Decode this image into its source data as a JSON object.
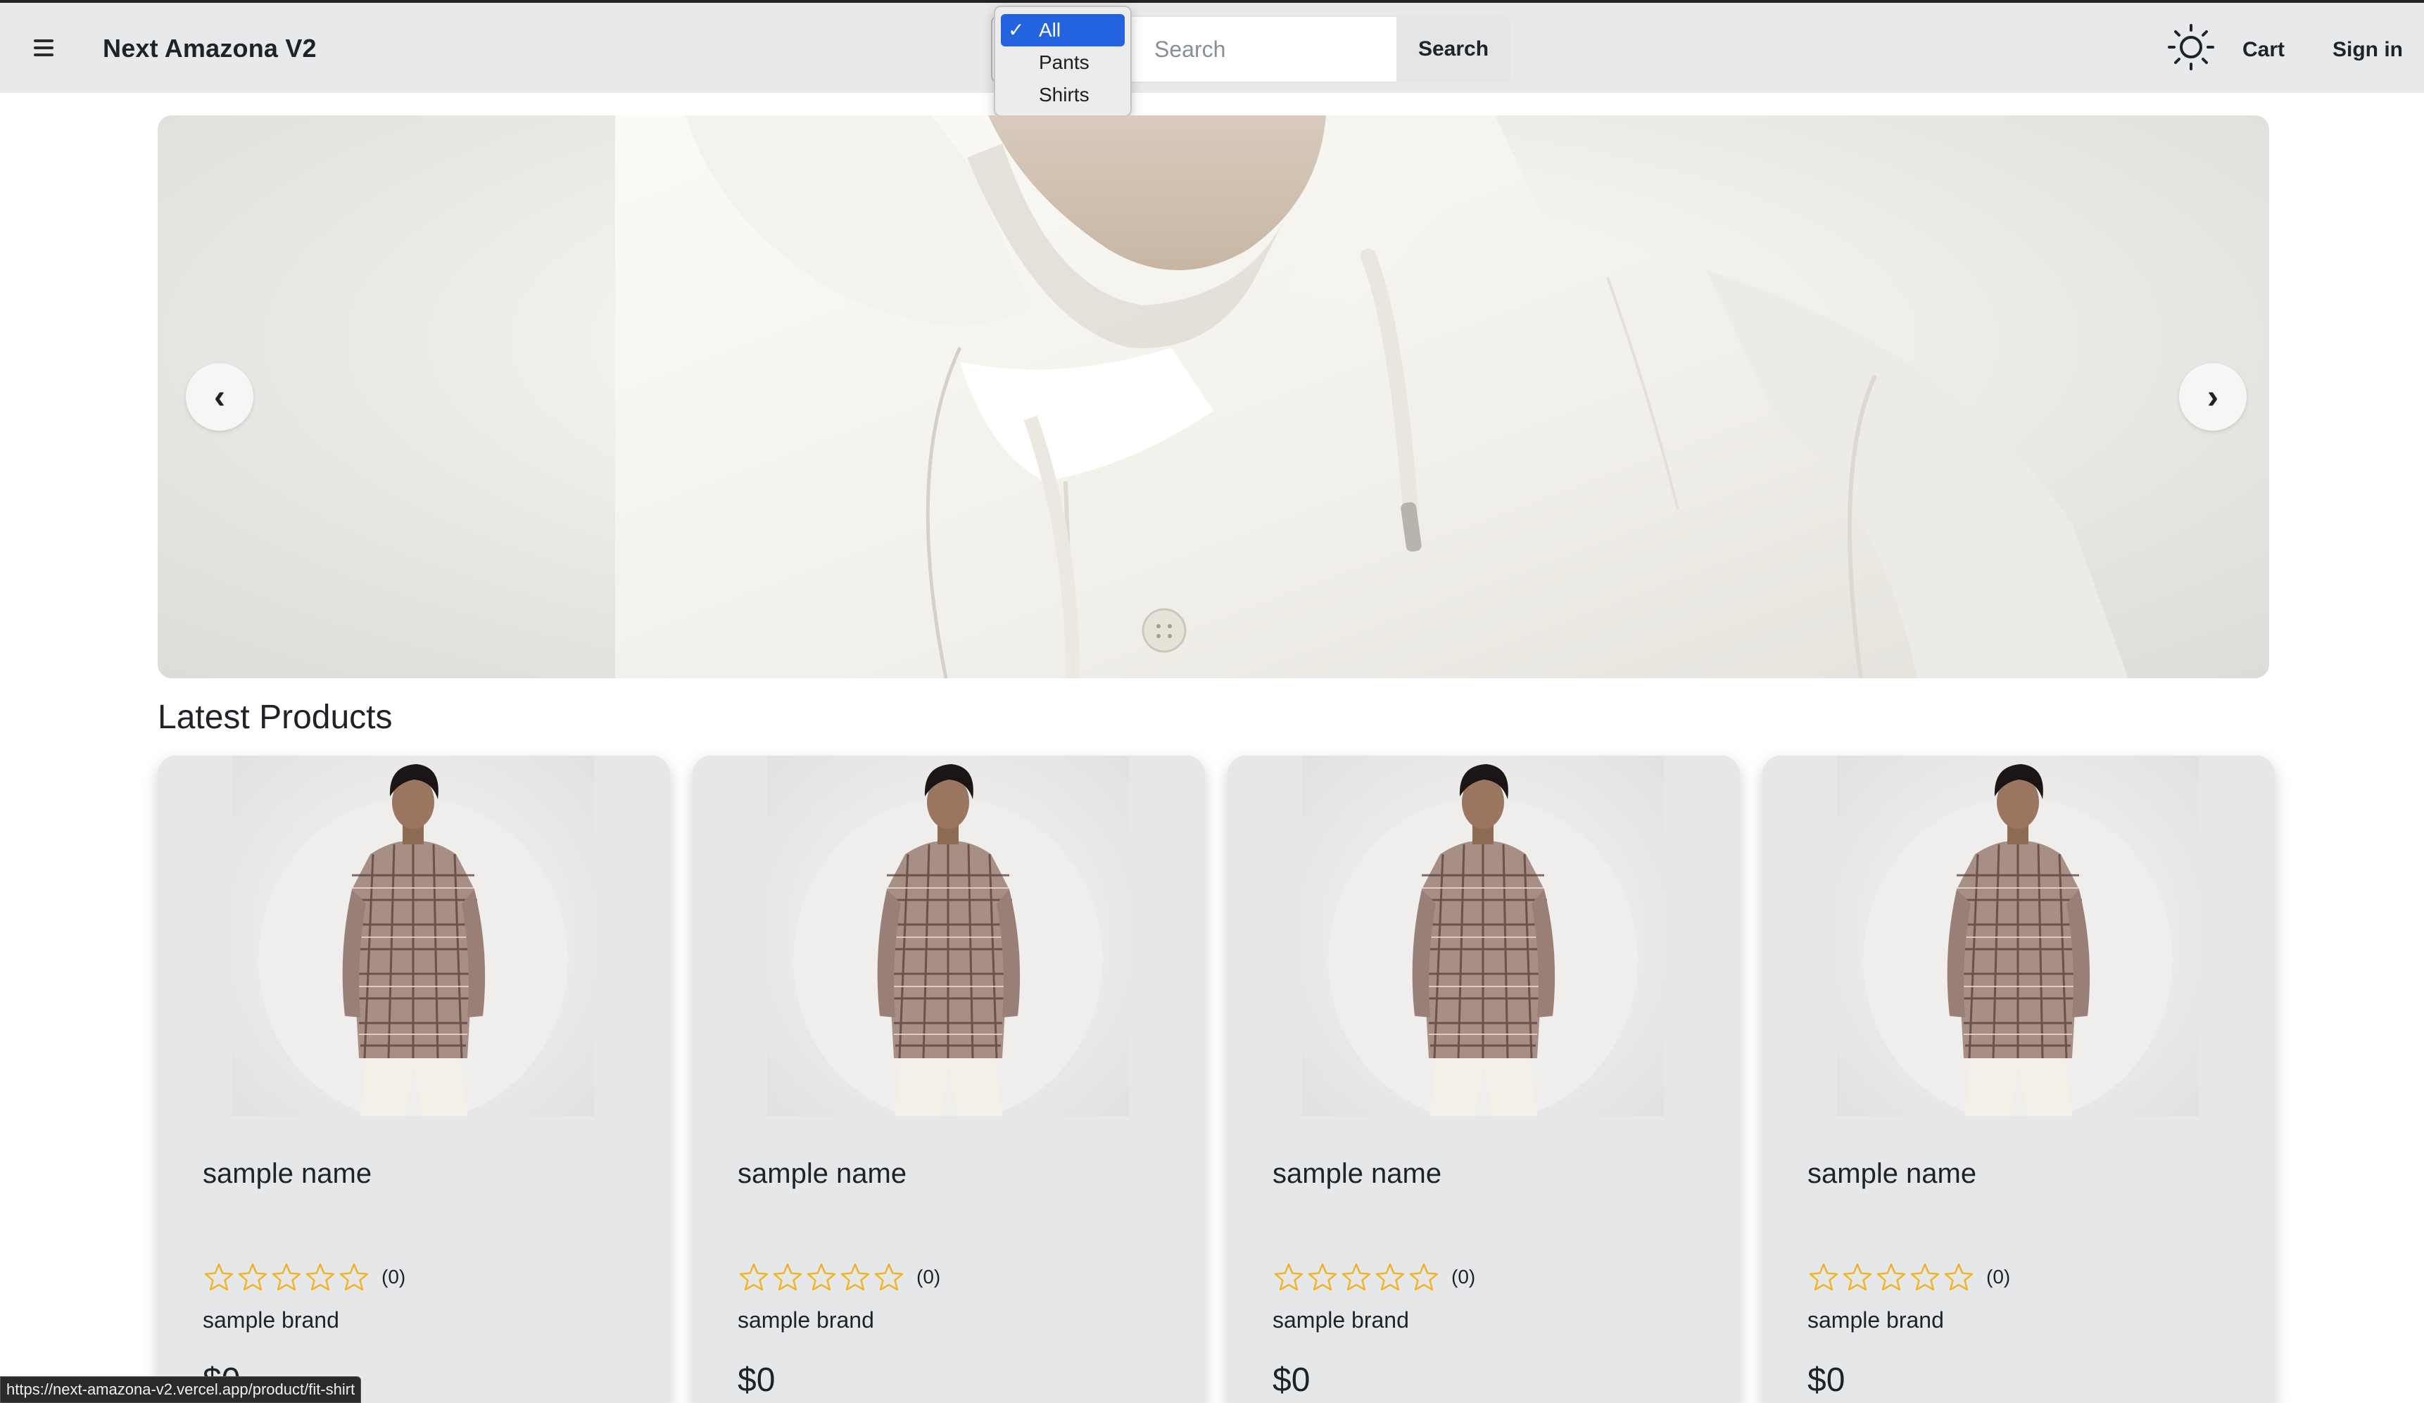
{
  "app": {
    "title": "Next Amazona V2"
  },
  "search": {
    "placeholder": "Search",
    "value": "",
    "button_label": "Search",
    "category_options": [
      "All",
      "Pants",
      "Shirts"
    ],
    "selected_category": "All"
  },
  "nav": {
    "cart_label": "Cart",
    "signin_label": "Sign in",
    "theme_icon": "sun-icon",
    "menu_icon": "hamburger-icon"
  },
  "carousel": {
    "prev_label": "‹",
    "next_label": "›"
  },
  "products": {
    "section_title": "Latest Products",
    "items": [
      {
        "name": "sample name",
        "rating_count": "(0)",
        "brand": "sample brand",
        "price": "$0",
        "stars": 0
      },
      {
        "name": "sample name",
        "rating_count": "(0)",
        "brand": "sample brand",
        "price": "$0",
        "stars": 0
      },
      {
        "name": "sample name",
        "rating_count": "(0)",
        "brand": "sample brand",
        "price": "$0",
        "stars": 0
      },
      {
        "name": "sample name",
        "rating_count": "(0)",
        "brand": "sample brand",
        "price": "$0",
        "stars": 0
      }
    ]
  },
  "status_bar": {
    "url": "https://next-amazona-v2.vercel.app/product/fit-shirt"
  },
  "colors": {
    "navbar_bg": "#e8e9ea",
    "card_bg": "#e6e7e8",
    "star_outline": "#f0b429",
    "dropdown_selected": "#2463e0"
  }
}
